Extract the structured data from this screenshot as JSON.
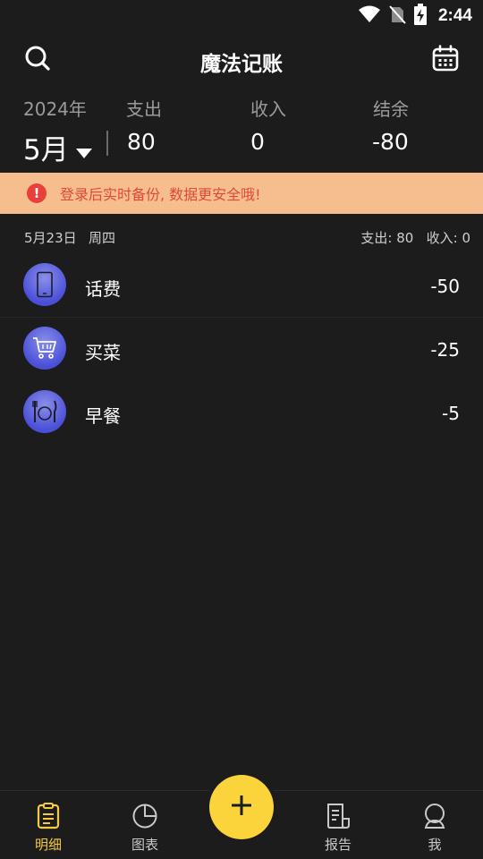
{
  "status_bar": {
    "time": "2:44"
  },
  "header": {
    "title": "魔法记账"
  },
  "summary": {
    "year": "2024年",
    "month": "5月",
    "expense_label": "支出",
    "expense_value": "80",
    "income_label": "收入",
    "income_value": "0",
    "balance_label": "结余",
    "balance_value": "-80"
  },
  "notice": {
    "icon": "!",
    "text": "登录后实时备份, 数据更安全哦!"
  },
  "day": {
    "date": "5月23日",
    "weekday": "周四",
    "totals": "支出: 80   收入: 0"
  },
  "transactions": [
    {
      "category": "话费",
      "amount": "-50",
      "icon": "phone-icon",
      "color": "#4a4fd8"
    },
    {
      "category": "买菜",
      "amount": "-25",
      "icon": "shopping-cart-icon",
      "color": "#4a4fd8"
    },
    {
      "category": "早餐",
      "amount": "-5",
      "icon": "fork-knife-plate-icon",
      "color": "#4a4fd8"
    }
  ],
  "nav": {
    "items": [
      {
        "label": "明细",
        "icon": "clipboard-list-icon",
        "active": true
      },
      {
        "label": "图表",
        "icon": "pie-chart-icon"
      },
      {
        "label": "报告",
        "icon": "report-document-icon"
      },
      {
        "label": "我",
        "icon": "user-profile-icon"
      }
    ],
    "add_icon": "plus-icon"
  },
  "colors": {
    "background": "#1c1c1c",
    "accent": "#fbd43b",
    "notice_bg": "#f6be8f",
    "notice_text": "#e0483c",
    "active_nav": "#f6c945"
  }
}
